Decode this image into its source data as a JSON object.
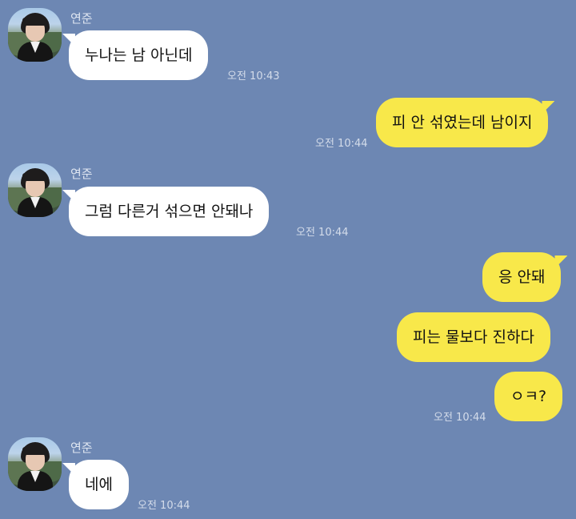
{
  "chat": {
    "messages": [
      {
        "sender": "연준",
        "text": "누나는 남 아닌데",
        "time": "오전 10:43"
      },
      {
        "sender": "me",
        "text": "피 안 섞였는데 남이지",
        "time": "오전 10:44"
      },
      {
        "sender": "연준",
        "text": "그럼 다른거 섞으면 안돼나",
        "time": "오전 10:44"
      },
      {
        "sender": "me",
        "text": "응 안돼",
        "time": ""
      },
      {
        "sender": "me",
        "text": "피는 물보다 진하다",
        "time": ""
      },
      {
        "sender": "me",
        "text": "ㅇㅋ?",
        "time": "오전 10:44"
      },
      {
        "sender": "연준",
        "text": "네에",
        "time": "오전 10:44"
      }
    ]
  },
  "colors": {
    "background": "#6d87b3",
    "incoming_bubble": "#ffffff",
    "outgoing_bubble": "#f8e84a"
  }
}
